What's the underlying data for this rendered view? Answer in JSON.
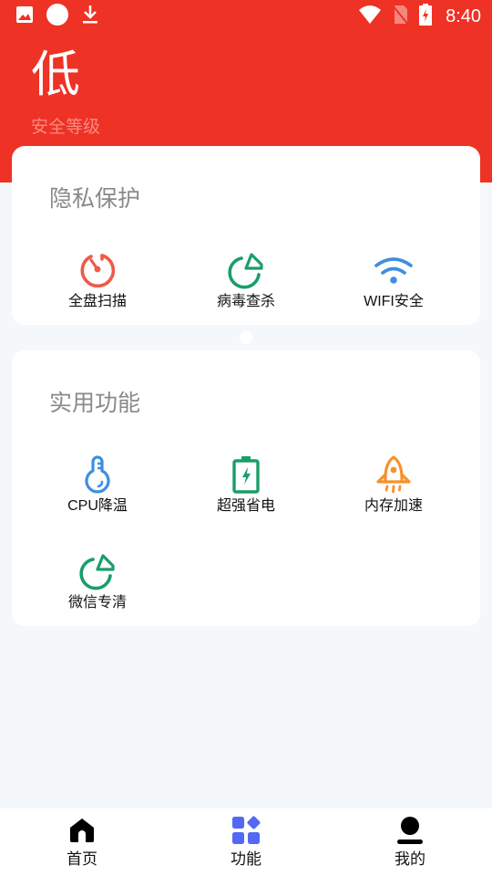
{
  "status_bar": {
    "time": "8:40",
    "left_icons": [
      "image-icon",
      "circle-icon",
      "download-icon"
    ],
    "right_icons": [
      "wifi-icon",
      "no-sim-icon",
      "battery-charging-icon"
    ]
  },
  "header": {
    "level": "低",
    "level_caption": "安全等级",
    "background_color": "#ee3225"
  },
  "privacy_card": {
    "title": "隐私保护",
    "items": [
      {
        "label": "全盘扫描",
        "icon": "disk-scan-icon",
        "color": "#ee5a4a"
      },
      {
        "label": "病毒查杀",
        "icon": "virus-kill-icon",
        "color": "#1a9e6a"
      },
      {
        "label": "WIFI安全",
        "icon": "wifi-security-icon",
        "color": "#3d8fe0"
      }
    ]
  },
  "tools_card": {
    "title": "实用功能",
    "items": [
      {
        "label": "CPU降温",
        "icon": "thermometer-icon",
        "color": "#3d8fe0"
      },
      {
        "label": "超强省电",
        "icon": "battery-saver-icon",
        "color": "#1a9e6a"
      },
      {
        "label": "内存加速",
        "icon": "rocket-icon",
        "color": "#f7922a"
      },
      {
        "label": "微信专清",
        "icon": "wechat-clean-icon",
        "color": "#1a9e6a"
      }
    ]
  },
  "bottom_nav": {
    "active_index": 1,
    "active_color": "#5468f5",
    "items": [
      {
        "label": "首页",
        "icon": "home-icon"
      },
      {
        "label": "功能",
        "icon": "apps-icon"
      },
      {
        "label": "我的",
        "icon": "profile-icon"
      }
    ]
  }
}
